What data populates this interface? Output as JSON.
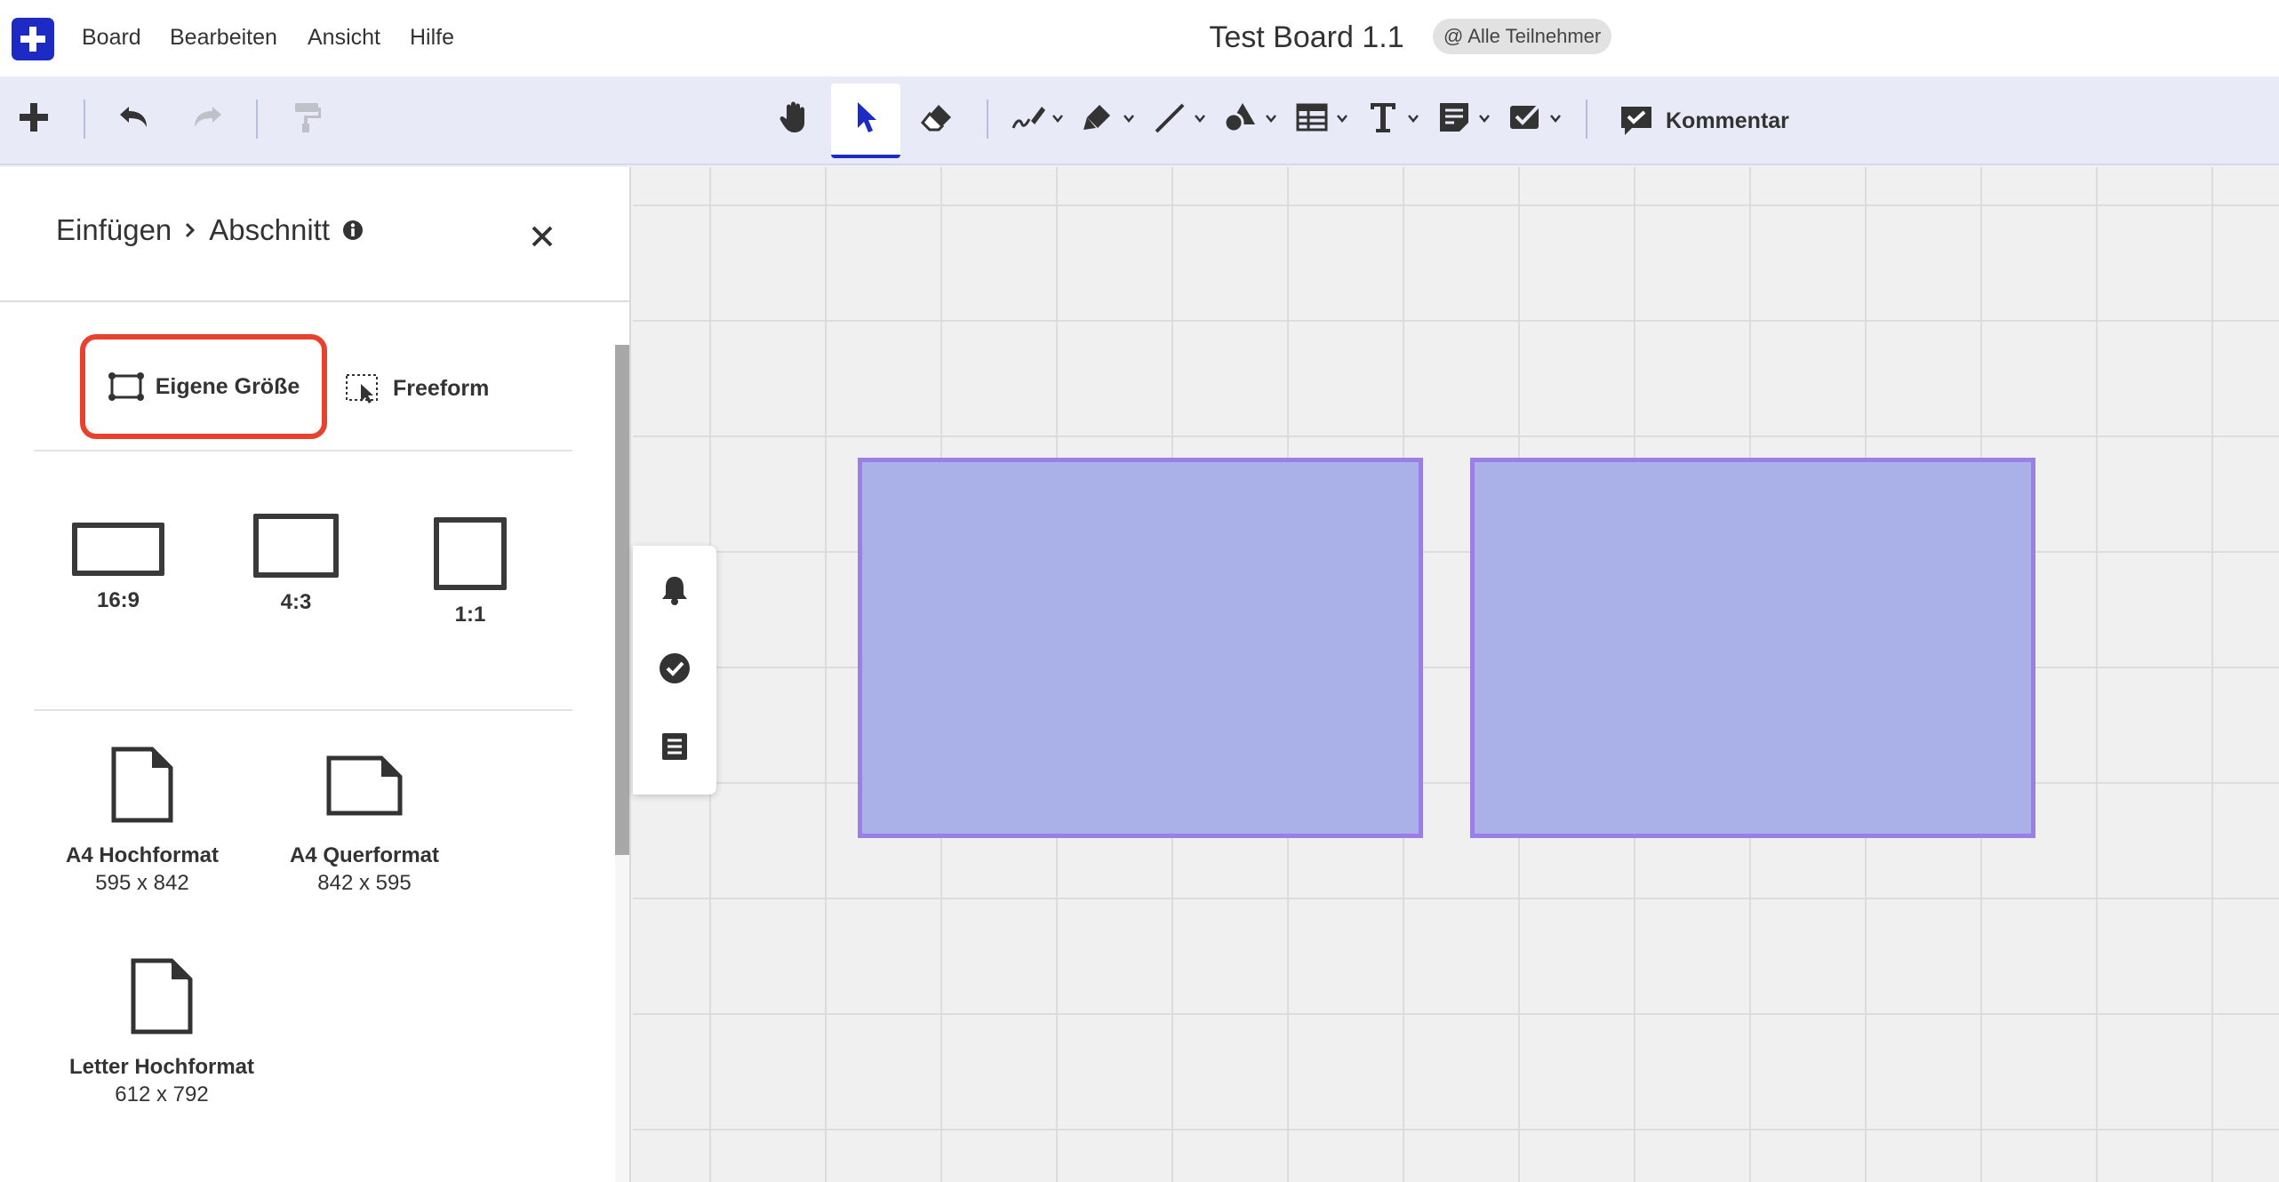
{
  "menubar": {
    "items": [
      "Board",
      "Bearbeiten",
      "Ansicht",
      "Hilfe"
    ],
    "title": "Test Board 1.1",
    "participants": "@ Alle Teilnehmer"
  },
  "toolbar": {
    "comment_label": "Kommentar",
    "active_tool": "select",
    "accent_color": "#1d2bc4"
  },
  "panel": {
    "breadcrumb": [
      "Einfügen",
      "Abschnitt"
    ],
    "modes": {
      "custom": "Eigene Größe",
      "freeform": "Freeform",
      "selected": "custom",
      "highlight_color": "#e8412d"
    },
    "ratios": [
      "16:9",
      "4:3",
      "1:1"
    ],
    "formats": [
      {
        "name": "A4 Hochformat",
        "dims": "595 x 842"
      },
      {
        "name": "A4 Querformat",
        "dims": "842 x 595"
      },
      {
        "name": "Letter Hochformat",
        "dims": "612 x 792"
      }
    ]
  },
  "canvas": {
    "section_fill": "#aab0e8",
    "section_border": "#9c7fe6"
  }
}
